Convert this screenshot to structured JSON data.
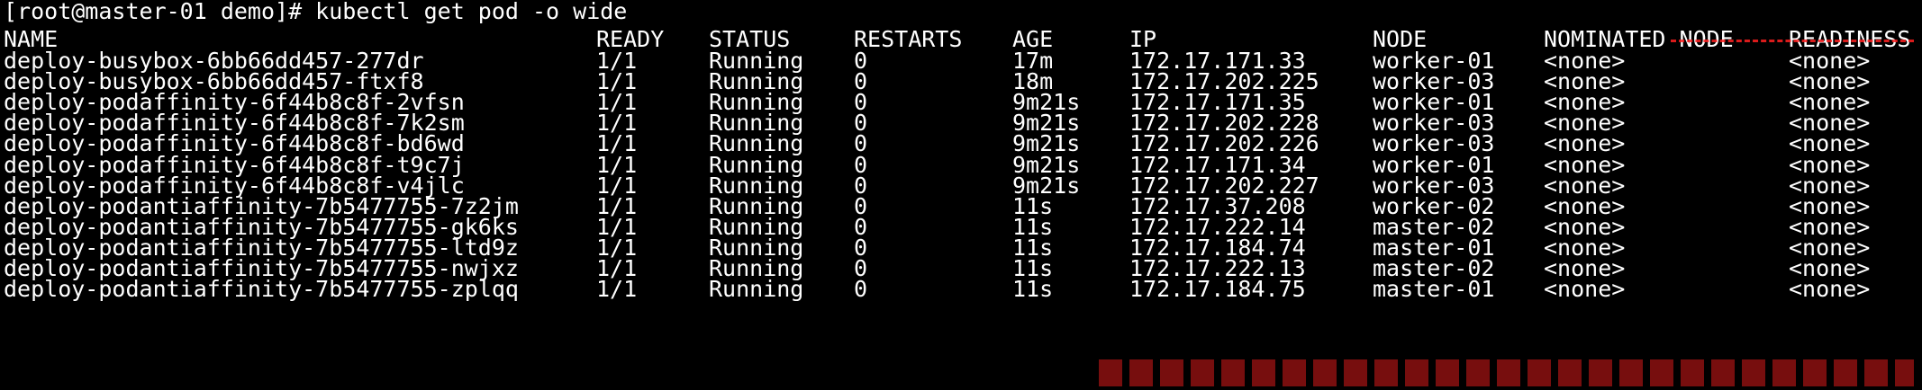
{
  "terminal": {
    "prompt_line": "[root@master-01 demo]# kubectl get pod -o wide",
    "colors": {
      "background": "#000000",
      "foreground": "#ffffff",
      "watermark": "#ff2020"
    },
    "header": {
      "name": "NAME",
      "ready": "READY",
      "status": "STATUS",
      "restarts": "RESTARTS",
      "age": "AGE",
      "ip": "IP",
      "node": "NODE",
      "nominated": "NOMINATED NODE",
      "readiness": "READINESS"
    },
    "rows": [
      {
        "name": "deploy-busybox-6bb66dd457-277dr",
        "ready": "1/1",
        "status": "Running",
        "restarts": "0",
        "age": "17m",
        "ip": "172.17.171.33",
        "node": "worker-01",
        "nominated": "<none>",
        "readiness": "<none>"
      },
      {
        "name": "deploy-busybox-6bb66dd457-ftxf8",
        "ready": "1/1",
        "status": "Running",
        "restarts": "0",
        "age": "18m",
        "ip": "172.17.202.225",
        "node": "worker-03",
        "nominated": "<none>",
        "readiness": "<none>"
      },
      {
        "name": "deploy-podaffinity-6f44b8c8f-2vfsn",
        "ready": "1/1",
        "status": "Running",
        "restarts": "0",
        "age": "9m21s",
        "ip": "172.17.171.35",
        "node": "worker-01",
        "nominated": "<none>",
        "readiness": "<none>"
      },
      {
        "name": "deploy-podaffinity-6f44b8c8f-7k2sm",
        "ready": "1/1",
        "status": "Running",
        "restarts": "0",
        "age": "9m21s",
        "ip": "172.17.202.228",
        "node": "worker-03",
        "nominated": "<none>",
        "readiness": "<none>"
      },
      {
        "name": "deploy-podaffinity-6f44b8c8f-bd6wd",
        "ready": "1/1",
        "status": "Running",
        "restarts": "0",
        "age": "9m21s",
        "ip": "172.17.202.226",
        "node": "worker-03",
        "nominated": "<none>",
        "readiness": "<none>"
      },
      {
        "name": "deploy-podaffinity-6f44b8c8f-t9c7j",
        "ready": "1/1",
        "status": "Running",
        "restarts": "0",
        "age": "9m21s",
        "ip": "172.17.171.34",
        "node": "worker-01",
        "nominated": "<none>",
        "readiness": "<none>"
      },
      {
        "name": "deploy-podaffinity-6f44b8c8f-v4jlc",
        "ready": "1/1",
        "status": "Running",
        "restarts": "0",
        "age": "9m21s",
        "ip": "172.17.202.227",
        "node": "worker-03",
        "nominated": "<none>",
        "readiness": "<none>"
      },
      {
        "name": "deploy-podantiaffinity-7b5477755-7z2jm",
        "ready": "1/1",
        "status": "Running",
        "restarts": "0",
        "age": "11s",
        "ip": "172.17.37.208",
        "node": "worker-02",
        "nominated": "<none>",
        "readiness": "<none>"
      },
      {
        "name": "deploy-podantiaffinity-7b5477755-gk6ks",
        "ready": "1/1",
        "status": "Running",
        "restarts": "0",
        "age": "11s",
        "ip": "172.17.222.14",
        "node": "master-02",
        "nominated": "<none>",
        "readiness": "<none>"
      },
      {
        "name": "deploy-podantiaffinity-7b5477755-ltd9z",
        "ready": "1/1",
        "status": "Running",
        "restarts": "0",
        "age": "11s",
        "ip": "172.17.184.74",
        "node": "master-01",
        "nominated": "<none>",
        "readiness": "<none>"
      },
      {
        "name": "deploy-podantiaffinity-7b5477755-nwjxz",
        "ready": "1/1",
        "status": "Running",
        "restarts": "0",
        "age": "11s",
        "ip": "172.17.222.13",
        "node": "master-02",
        "nominated": "<none>",
        "readiness": "<none>"
      },
      {
        "name": "deploy-podantiaffinity-7b5477755-zplqq",
        "ready": "1/1",
        "status": "Running",
        "restarts": "0",
        "age": "11s",
        "ip": "172.17.184.75",
        "node": "master-01",
        "nominated": "<none>",
        "readiness": "<none>"
      }
    ]
  }
}
